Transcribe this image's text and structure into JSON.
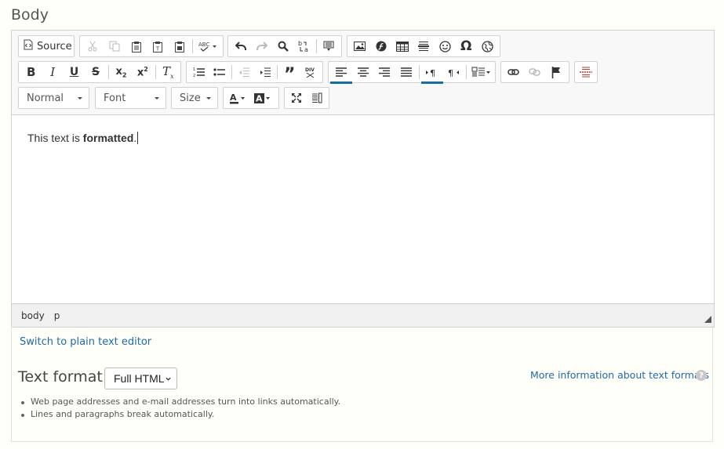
{
  "field": {
    "label": "Body"
  },
  "toolbar": {
    "source_label": "Source",
    "format_combo": "Normal",
    "font_combo": "Font",
    "size_combo": "Size"
  },
  "content": {
    "text_before": "This text is ",
    "text_bold": "formatted",
    "text_after": "."
  },
  "pathbar": {
    "items": [
      "body",
      "p"
    ]
  },
  "links": {
    "switch_editor": "Switch to plain text editor",
    "more_info": "More information about text formats"
  },
  "text_format": {
    "label": "Text format",
    "selected": "Full HTML",
    "tips": [
      "Web page addresses and e-mail addresses turn into links automatically.",
      "Lines and paragraphs break automatically."
    ]
  },
  "icons": [
    "source-icon",
    "cut-icon",
    "copy-icon",
    "paste-icon",
    "paste-text-icon",
    "paste-word-icon",
    "spellcheck-icon",
    "undo-icon",
    "redo-icon",
    "find-icon",
    "replace-icon",
    "show-blocks-icon",
    "image-icon",
    "flash-icon",
    "table-icon",
    "horizontal-line-icon",
    "smiley-icon",
    "special-char-icon",
    "iframe-icon",
    "bold-icon",
    "italic-icon",
    "underline-icon",
    "strike-icon",
    "subscript-icon",
    "superscript-icon",
    "remove-format-icon",
    "numbered-list-icon",
    "bulleted-list-icon",
    "outdent-icon",
    "indent-icon",
    "blockquote-icon",
    "div-icon",
    "align-left-icon",
    "align-center-icon",
    "align-right-icon",
    "justify-icon",
    "ltr-icon",
    "rtl-icon",
    "language-icon",
    "link-icon",
    "unlink-icon",
    "anchor-icon",
    "page-break-icon",
    "text-color-icon",
    "bg-color-icon",
    "maximize-icon",
    "show-blocks-2-icon",
    "help-icon"
  ],
  "colors": {
    "accent": "#1a6e9e",
    "link": "#2369a6"
  }
}
